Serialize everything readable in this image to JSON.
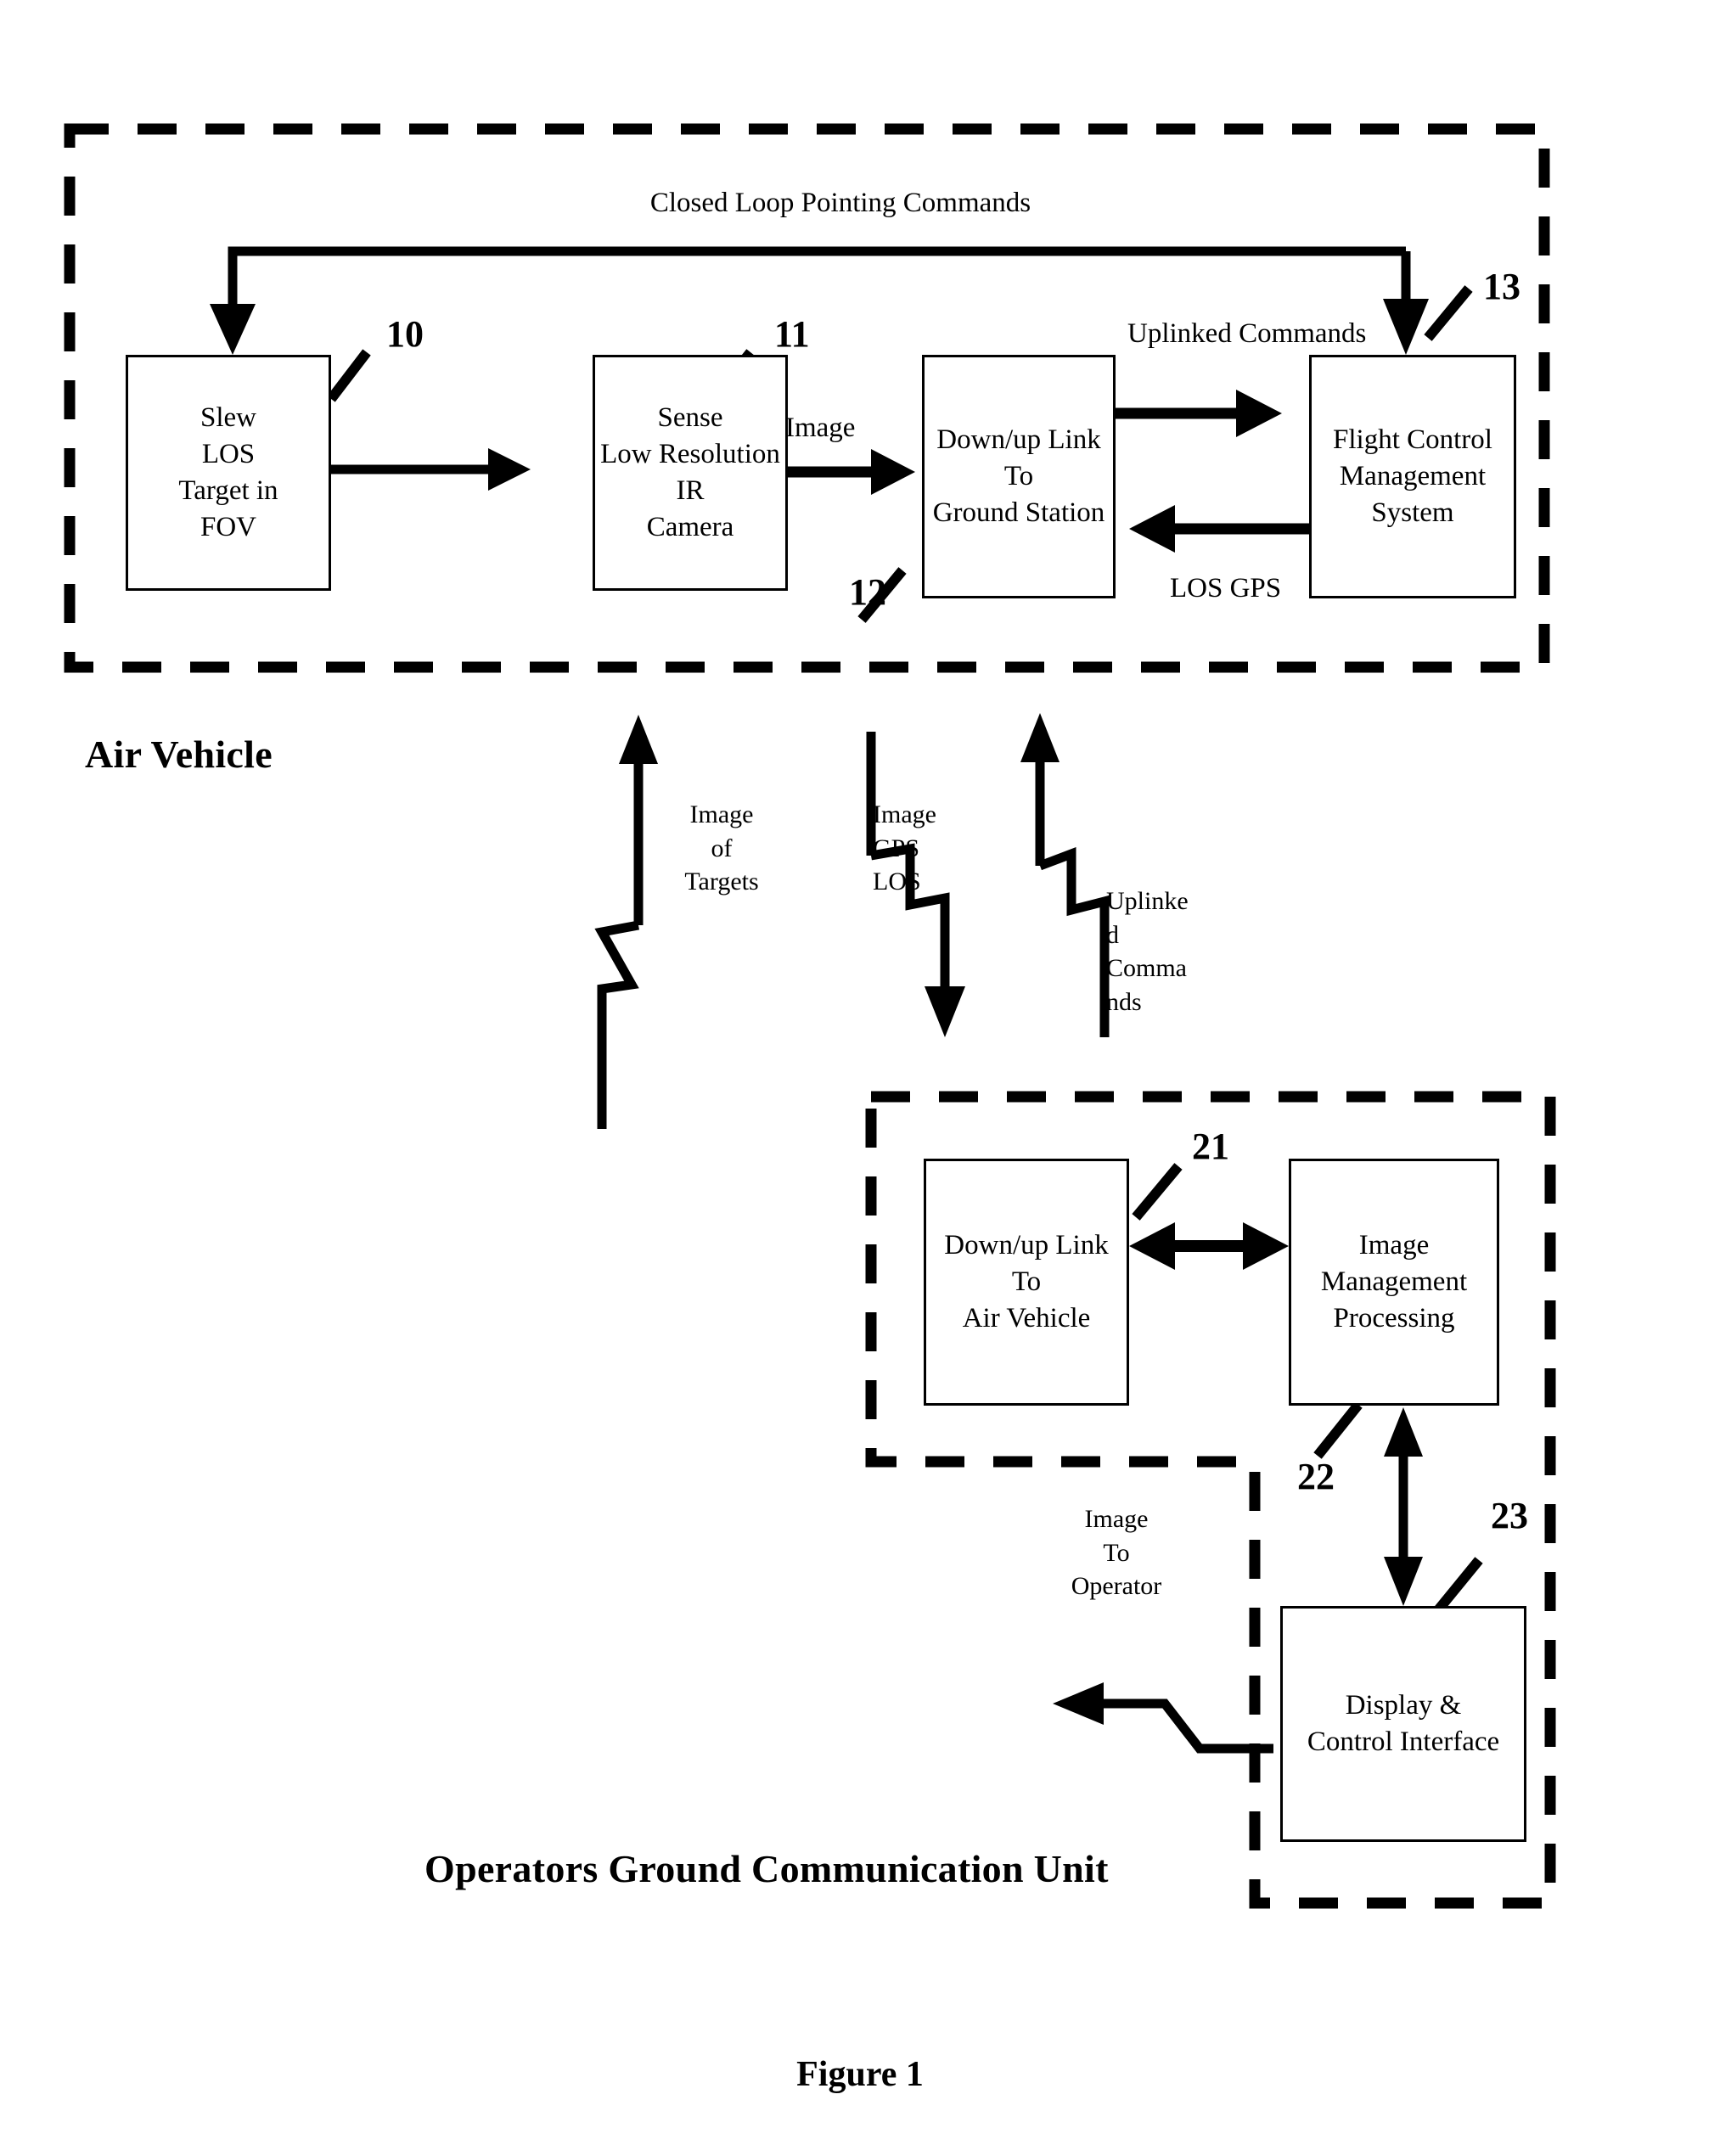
{
  "figure": {
    "caption": "Figure 1"
  },
  "sections": {
    "air_vehicle": {
      "title": "Air Vehicle"
    },
    "ground_unit": {
      "title": "Operators Ground Communication Unit"
    }
  },
  "boxes": {
    "slew_los": {
      "text": "Slew\nLOS\nTarget in\nFOV",
      "ref": "10"
    },
    "ir_camera": {
      "text": "Sense\nLow Resolution\nIR\nCamera",
      "ref": "11"
    },
    "downup_link_ground": {
      "text": "Down/up  Link\nTo\nGround Station",
      "ref": "12"
    },
    "flight_control": {
      "text": "Flight Control\nManagement\nSystem",
      "ref": "13"
    },
    "downup_link_air": {
      "text": "Down/up Link\nTo\nAir Vehicle",
      "ref": "21"
    },
    "image_management": {
      "text": "Image\nManagement\nProcessing",
      "ref": "22"
    },
    "display_control": {
      "text": "Display  &\nControl Interface",
      "ref": "23"
    }
  },
  "edge_labels": {
    "closed_loop": "Closed Loop Pointing Commands",
    "image": "Image",
    "uplinked_commands_top": "Uplinked Commands",
    "los_gps": "LOS   GPS",
    "image_of_targets": "Image\nof\nTargets",
    "image_gps_los": "Image\nGPS\nLOS",
    "uplinked_commands_mid": "Uplinke\nd\nComma\nnds",
    "image_to_operator": "Image\nTo\nOperator"
  },
  "colors": {
    "ink": "#000000",
    "paper": "#ffffff"
  }
}
